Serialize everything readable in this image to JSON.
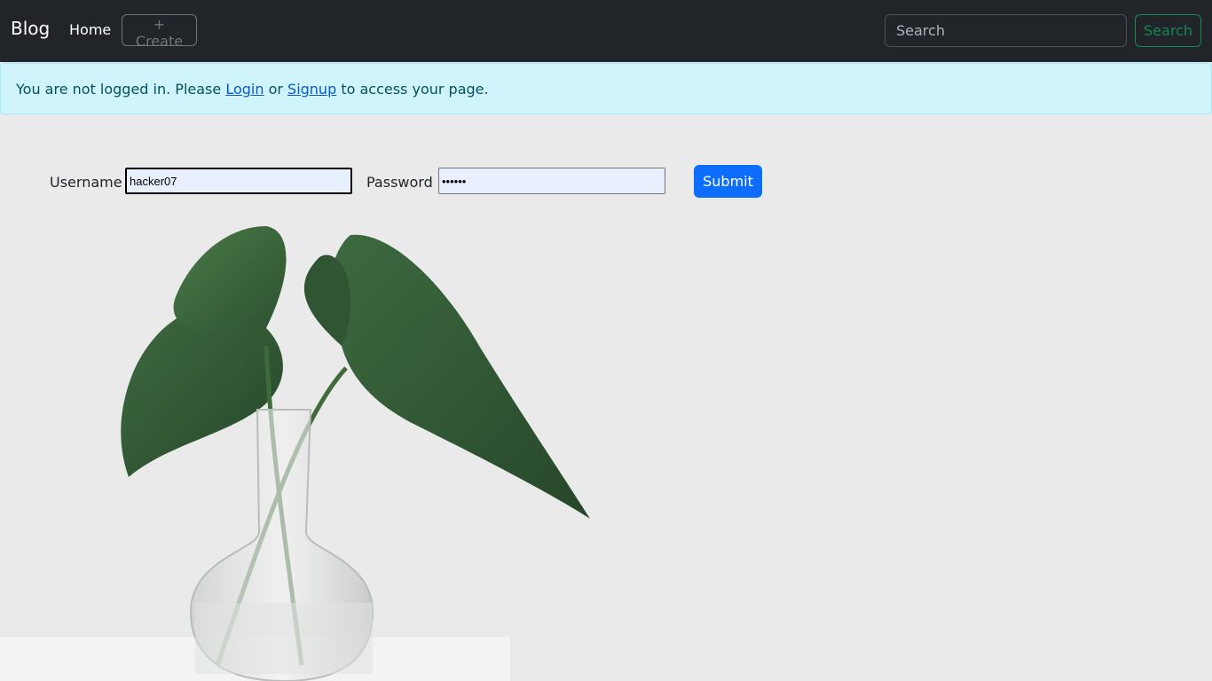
{
  "navbar": {
    "brand": "Blog",
    "home_label": "Home",
    "create_label": "+ Create",
    "search_placeholder": "Search",
    "search_button_label": "Search"
  },
  "alert": {
    "prefix": "You are not logged in. Please ",
    "login_link": "Login",
    "middle": " or ",
    "signup_link": "Signup",
    "suffix": " to access your page."
  },
  "login_form": {
    "username_label": "Username :",
    "username_value": "hacker07",
    "password_label": "Password :",
    "password_value": "secret",
    "submit_label": "Submit"
  },
  "colors": {
    "navbar_bg": "#212529",
    "alert_bg": "#cff4fc",
    "primary": "#0d6efd",
    "success": "#198754"
  }
}
